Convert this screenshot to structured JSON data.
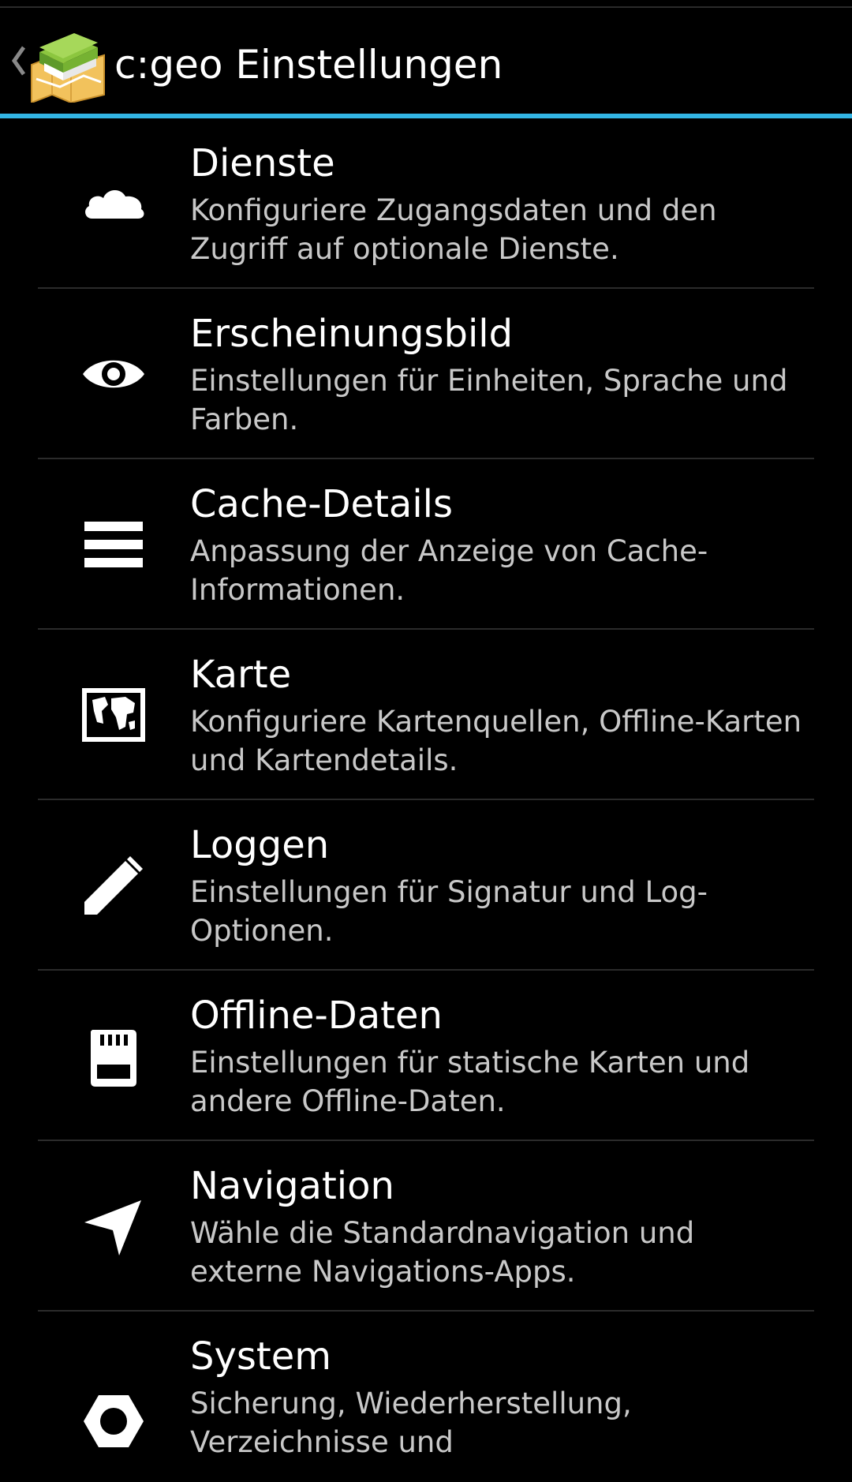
{
  "action_bar": {
    "title": "c:geo Einstellungen",
    "up_icon": "chevron-left-icon",
    "app_icon": "cgeo-app-icon"
  },
  "accent_color": "#33b5e5",
  "items": [
    {
      "label": "Dienste",
      "summary": "Konfiguriere Zugangsdaten und den Zugriff auf optionale Dienste.",
      "icon": "cloud-icon"
    },
    {
      "label": "Erscheinungsbild",
      "summary": "Einstellungen für Einheiten, Sprache und Farben.",
      "icon": "eye-icon"
    },
    {
      "label": "Cache-Details",
      "summary": "Anpassung der Anzeige von Cache-Informationen.",
      "icon": "list-lines-icon"
    },
    {
      "label": "Karte",
      "summary": "Konfiguriere Kartenquellen, Offline-Karten und Kartendetails.",
      "icon": "map-icon"
    },
    {
      "label": "Loggen",
      "summary": "Einstellungen für Signatur und Log-Optionen.",
      "icon": "pencil-icon"
    },
    {
      "label": "Offline-Daten",
      "summary": "Einstellungen für statische Karten und andere Offline-Daten.",
      "icon": "sd-card-icon"
    },
    {
      "label": "Navigation",
      "summary": "Wähle die Standardnavigation und externe Navigations-Apps.",
      "icon": "navigation-arrow-icon"
    },
    {
      "label": "System",
      "summary": "Sicherung, Wiederherstellung, Verzeichnisse und",
      "icon": "hexagon-nut-icon"
    }
  ]
}
